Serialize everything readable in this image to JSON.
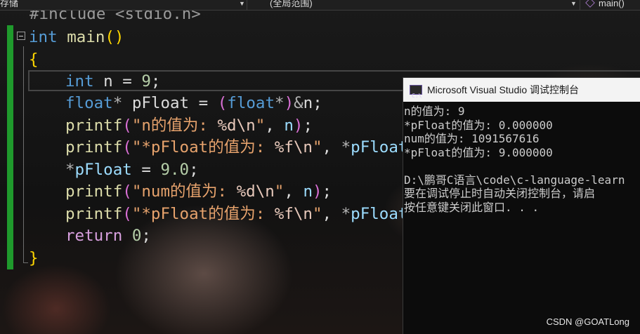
{
  "navbar": {
    "left_text": "存储",
    "mid_text": "(全局范围)",
    "right_text": "main()"
  },
  "code": {
    "include_line": "#include <stdio.h>",
    "lines": [
      {
        "id": "l1",
        "tokens": [
          [
            "kw",
            "int"
          ],
          [
            "pun",
            " "
          ],
          [
            "fn",
            "main"
          ],
          [
            "br1",
            "()"
          ]
        ]
      },
      {
        "id": "l2",
        "tokens": [
          [
            "br1",
            "{"
          ]
        ]
      },
      {
        "id": "l3",
        "tokens": [
          [
            "kw",
            "int"
          ],
          [
            "pun",
            " n = "
          ],
          [
            "num",
            "9"
          ],
          [
            "pun",
            ";"
          ]
        ]
      },
      {
        "id": "l4",
        "tokens": [
          [
            "kw",
            "float"
          ],
          [
            "op",
            "*"
          ],
          [
            "pun",
            " pFloat = "
          ],
          [
            "br2",
            "("
          ],
          [
            "kw",
            "float"
          ],
          [
            "op",
            "*"
          ],
          [
            "br2",
            ")"
          ],
          [
            "op",
            "&"
          ],
          [
            "pun",
            "n;"
          ]
        ]
      },
      {
        "id": "l5",
        "tokens": [
          [
            "fn",
            "printf"
          ],
          [
            "br2",
            "("
          ],
          [
            "str",
            "\"n的值为: "
          ],
          [
            "esc",
            "%d\\n"
          ],
          [
            "str",
            "\""
          ],
          [
            "pun",
            ", "
          ],
          [
            "var",
            "n"
          ],
          [
            "br2",
            ")"
          ],
          [
            "pun",
            ";"
          ]
        ]
      },
      {
        "id": "l6",
        "tokens": [
          [
            "fn",
            "printf"
          ],
          [
            "br2",
            "("
          ],
          [
            "str",
            "\"*pFloat的值为: "
          ],
          [
            "esc",
            "%f\\n"
          ],
          [
            "str",
            "\""
          ],
          [
            "pun",
            ", "
          ],
          [
            "op",
            "*"
          ],
          [
            "var",
            "pFloat"
          ],
          [
            "br2",
            ")"
          ]
        ]
      },
      {
        "id": "l7",
        "tokens": [
          [
            "op",
            "*"
          ],
          [
            "var",
            "pFloat"
          ],
          [
            "pun",
            " = "
          ],
          [
            "num",
            "9.0"
          ],
          [
            "pun",
            ";"
          ]
        ]
      },
      {
        "id": "l8",
        "tokens": [
          [
            "fn",
            "printf"
          ],
          [
            "br2",
            "("
          ],
          [
            "str",
            "\"num的值为: "
          ],
          [
            "esc",
            "%d\\n"
          ],
          [
            "str",
            "\""
          ],
          [
            "pun",
            ", "
          ],
          [
            "var",
            "n"
          ],
          [
            "br2",
            ")"
          ],
          [
            "pun",
            ";"
          ]
        ]
      },
      {
        "id": "l9",
        "tokens": [
          [
            "fn",
            "printf"
          ],
          [
            "br2",
            "("
          ],
          [
            "str",
            "\"*pFloat的值为: "
          ],
          [
            "esc",
            "%f\\n"
          ],
          [
            "str",
            "\""
          ],
          [
            "pun",
            ", "
          ],
          [
            "op",
            "*"
          ],
          [
            "var",
            "pFloat"
          ],
          [
            "br2",
            ")"
          ]
        ]
      },
      {
        "id": "l10",
        "tokens": [
          [
            "cf",
            "return"
          ],
          [
            "pun",
            " "
          ],
          [
            "num",
            "0"
          ],
          [
            "pun",
            ";"
          ]
        ]
      },
      {
        "id": "l11",
        "tokens": [
          [
            "br1",
            "}"
          ]
        ]
      }
    ]
  },
  "console": {
    "title": "Microsoft Visual Studio 调试控制台",
    "icon_label": "C:\\",
    "output_lines": [
      "n的值为: 9",
      "*pFloat的值为: 0.000000",
      "num的值为: 1091567616",
      "*pFloat的值为: 9.000000",
      "",
      "D:\\鹏哥C语言\\code\\c-language-learn",
      "要在调试停止时自动关闭控制台，请启",
      "按任意键关闭此窗口. . ."
    ]
  },
  "watermark": "CSDN @GOATLong",
  "colors": {
    "keyword": "#569cd6",
    "control": "#d8a0df",
    "function": "#dcdcaa",
    "string": "#e6a26c",
    "number": "#b5cea8",
    "variable": "#9cdcfe",
    "change_bar": "#1f9a2c"
  }
}
